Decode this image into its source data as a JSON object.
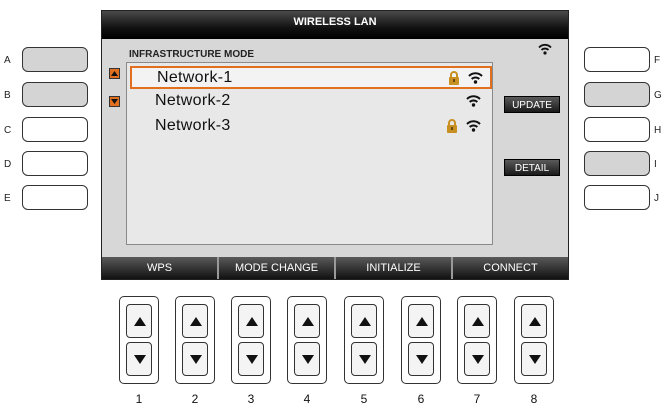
{
  "window": {
    "title": "WIRELESS LAN"
  },
  "mode_label": "INFRASTRUCTURE MODE",
  "networks": [
    {
      "name": "Network-1",
      "locked": true,
      "selected": true,
      "icons": [
        "lock-icon",
        "wifi-signal-icon"
      ]
    },
    {
      "name": "Network-2",
      "locked": false,
      "selected": false,
      "icons": [
        "wifi-signal-icon"
      ]
    },
    {
      "name": "Network-3",
      "locked": true,
      "selected": false,
      "icons": [
        "lock-icon",
        "wifi-signal-icon"
      ]
    }
  ],
  "right_buttons": {
    "update": "UPDATE",
    "detail": "DETAIL"
  },
  "bottom_buttons": [
    "WPS",
    "MODE CHANGE",
    "INITIALIZE",
    "CONNECT"
  ],
  "side_labels": {
    "left": [
      "A",
      "B",
      "C",
      "D",
      "E"
    ],
    "right": [
      "F",
      "G",
      "H",
      "I",
      "J"
    ]
  },
  "hardware_numbers": [
    "1",
    "2",
    "3",
    "4",
    "5",
    "6",
    "7",
    "8"
  ],
  "colors": {
    "accent": "#e07020",
    "lock": "#c89020",
    "titlebar": "#111111"
  }
}
